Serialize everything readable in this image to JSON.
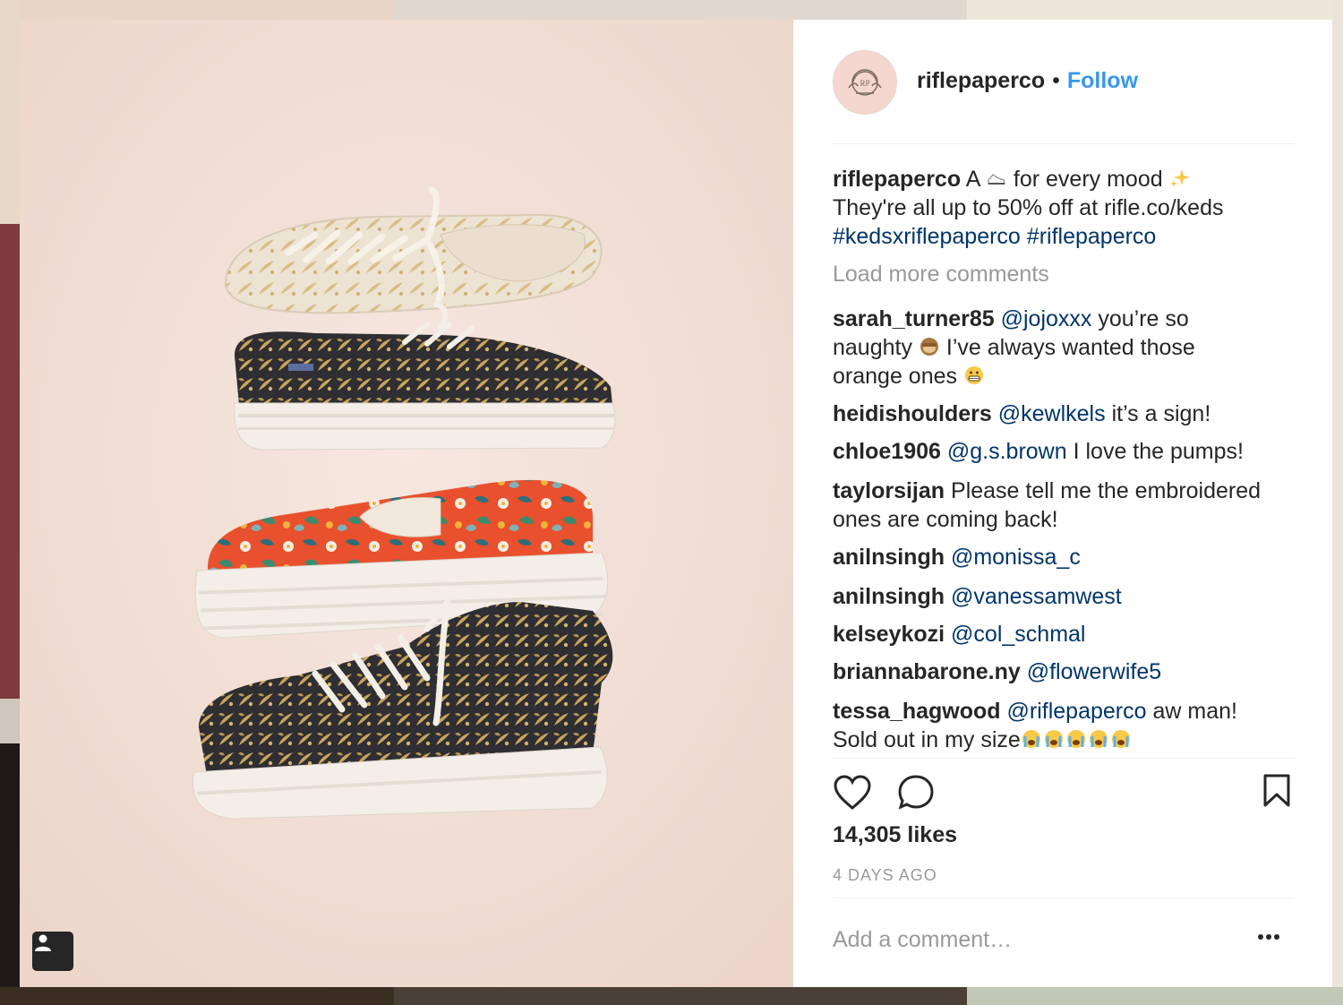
{
  "post": {
    "username": "riflepaperco",
    "follow_label": "Follow",
    "dot": "•"
  },
  "caption": {
    "user": "riflepaperco",
    "text_a": "A",
    "text_b": "for every mood",
    "line2": "They're all up to 50% off at rifle.co/keds",
    "tag1": "#kedsxriflepaperco",
    "tag2": "#riflepaperco"
  },
  "load_more": "Load more comments",
  "comments": [
    {
      "user": "sarah_turner85",
      "mention": "@jojoxxx",
      "text1": "you’re so",
      "text2": "naughty",
      "text3": "I’ve always wanted those",
      "text4": "orange ones"
    },
    {
      "user": "heidishoulders",
      "mention": "@kewlkels",
      "text": "it’s a sign!"
    },
    {
      "user": "chloe1906",
      "mention": "@g.s.brown",
      "text": "I love the pumps!"
    },
    {
      "user": "taylorsijan",
      "text1": "Please tell me the embroidered",
      "text2": "ones are coming back!"
    },
    {
      "user": "anilnsingh",
      "mention": "@monissa_c"
    },
    {
      "user": "anilnsingh",
      "mention": "@vanessamwest"
    },
    {
      "user": "kelseykozi",
      "mention": "@col_schmal"
    },
    {
      "user": "briannabarone.ny",
      "mention": "@flowerwife5"
    },
    {
      "user": "tessa_hagwood",
      "mention": "@riflepaperco",
      "text1": "aw man!",
      "text2": "Sold out in my size"
    }
  ],
  "likes": "14,305 likes",
  "date": "4 DAYS AGO",
  "add_comment_placeholder": "Add a comment…",
  "colors": {
    "link": "#3897f0",
    "mention": "#003569",
    "muted": "#999999",
    "text": "#262626",
    "photo_bg": "#f1dfd6"
  },
  "icons": [
    "heart-icon",
    "comment-icon",
    "bookmark-icon",
    "more-options-icon",
    "tag-people-icon",
    "sneaker-emoji",
    "sparkles-emoji",
    "see-no-evil-monkey-emoji",
    "grimacing-emoji",
    "crying-face-emoji"
  ]
}
